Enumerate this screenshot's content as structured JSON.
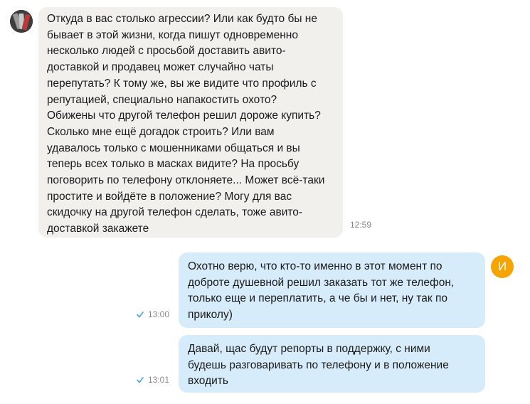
{
  "messages": [
    {
      "direction": "incoming",
      "text": "Откуда в вас столько агрессии? Или как будто бы не\nбывает в этой жизни, когда пишут одновременно\nнесколько людей с просьбой доставить авито-\nдоставкой и продавец может случайно чаты\nперепутать? К тому же, вы же видите что профиль с\nрепутацией, специально напакостить охото?\nОбижены что другой телефон решил дороже купить?\nСколько мне ещё догадок строить? Или вам\nудавалось только с мошенниками общаться и вы\nтеперь всех только в масках видите? На просьбу\nпоговорить по телефону отклоняете... Может всё-таки\nпростите и войдёте в положение? Могу для вас\nскидочку на другой телефон сделать, тоже авито-\nдоставкой закажете",
      "time": "12:59"
    },
    {
      "direction": "outgoing",
      "text": "Охотно верю, что кто-то именно в этот момент по\nдоброте душевной решил заказать тот же телефон,\nтолько еще и переплатить, а че бы и нет, ну так по\nприколу)",
      "time": "13:00"
    },
    {
      "direction": "outgoing",
      "text": "Давай, щас будут репорты в поддержку, с ними\nбудешь разговаривать по телефону и в положение\nвходить",
      "time": "13:01"
    }
  ],
  "avatars": {
    "me_letter": "И",
    "me_color": "#f5a400",
    "peer_icon": "user-photo-avatar"
  },
  "colors": {
    "incoming_bubble": "#f2f0ec",
    "outgoing_bubble": "#d7ecfb",
    "check": "#4aa3e0"
  }
}
